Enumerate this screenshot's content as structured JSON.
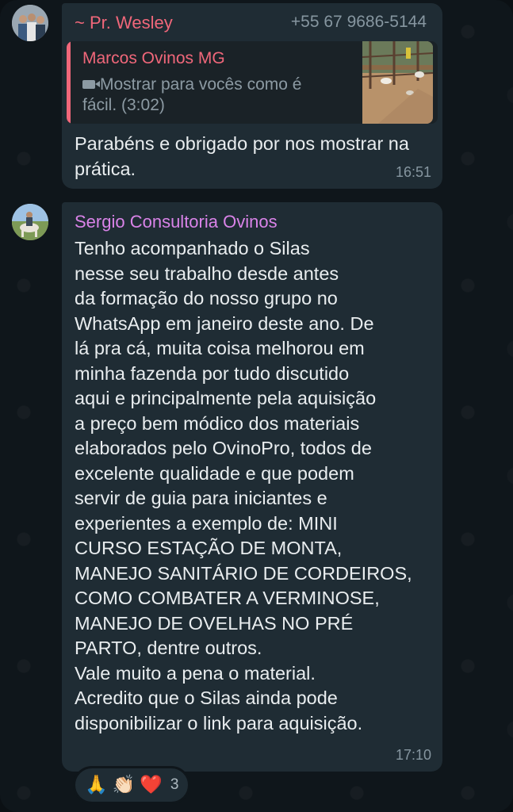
{
  "message1": {
    "sender": "~ Pr. Wesley",
    "phone": "+55 67 9686-5144",
    "quoted": {
      "author": "Marcos Ovinos MG",
      "text": "Mostrar para vocês como é fácil. (3:02)",
      "media_type": "video-icon"
    },
    "text": "Parabéns e obrigado por nos mostrar na prática.",
    "time": "16:51"
  },
  "message2": {
    "sender": "Sergio Consultoria Ovinos",
    "text": "Tenho acompanhado o Silas\nnesse seu trabalho desde antes\nda formação do nosso grupo no\nWhatsApp em janeiro deste ano. De\nlá pra cá, muita coisa melhorou em\nminha fazenda por tudo discutido\naqui e principalmente pela aquisição\na preço bem módico dos materiais\nelaborados pelo OvinoPro, todos de\nexcelente qualidade e que podem\nservir de guia para iniciantes e\nexperientes a exemplo de: MINI\nCURSO ESTAÇÃO DE MONTA,\nMANEJO SANITÁRIO DE CORDEIROS,\nCOMO COMBATER A VERMINOSE,\nMANEJO DE OVELHAS NO PRÉ\nPARTO, dentre outros.\nVale muito a pena o material.\nAcredito que o Silas ainda pode\ndisponibilizar o link para aquisição.",
    "time": "17:10",
    "reactions": {
      "emojis": [
        "🙏",
        "👏🏻",
        "❤️"
      ],
      "count": "3"
    }
  },
  "colors": {
    "background": "#0f161b",
    "bubble": "#1f2c34",
    "sender1": "#f0677a",
    "sender2": "#d983e8",
    "meta": "#8696a0"
  }
}
